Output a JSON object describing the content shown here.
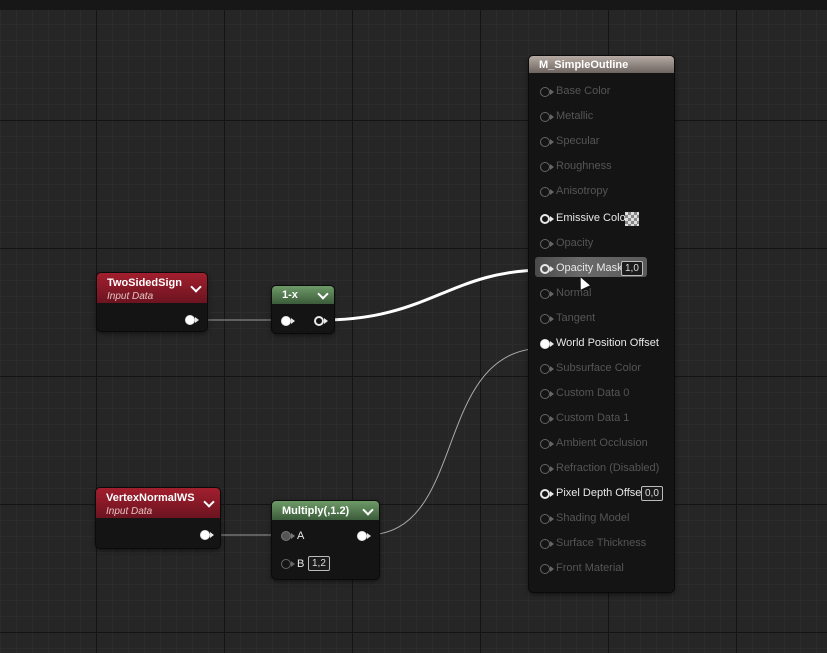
{
  "graph": {
    "two_sided_node": {
      "title": "TwoSidedSign",
      "subtitle": "Input Data"
    },
    "one_minus_node": {
      "title": "1-x"
    },
    "vertex_node": {
      "title": "VertexNormalWS",
      "subtitle": "Input Data"
    },
    "multiply_node": {
      "title": "Multiply(,1.2)",
      "pin_a": "A",
      "pin_b": "B",
      "pin_b_value": "1,2"
    },
    "material_node": {
      "title": "M_SimpleOutline",
      "pins": [
        {
          "label": "Base Color",
          "active": false
        },
        {
          "label": "Metallic",
          "active": false
        },
        {
          "label": "Specular",
          "active": false
        },
        {
          "label": "Roughness",
          "active": false
        },
        {
          "label": "Anisotropy",
          "active": false
        },
        {
          "label": "Emissive Color",
          "active": true
        },
        {
          "label": "Opacity",
          "active": false
        },
        {
          "label": "Opacity Mask",
          "active": true,
          "value": "1,0"
        },
        {
          "label": "Normal",
          "active": false
        },
        {
          "label": "Tangent",
          "active": false
        },
        {
          "label": "World Position Offset",
          "active": true
        },
        {
          "label": "Subsurface Color",
          "active": false
        },
        {
          "label": "Custom Data 0",
          "active": false
        },
        {
          "label": "Custom Data 1",
          "active": false
        },
        {
          "label": "Ambient Occlusion",
          "active": false
        },
        {
          "label": "Refraction (Disabled)",
          "active": false
        },
        {
          "label": "Pixel Depth Offset",
          "active": true,
          "value": "0,0"
        },
        {
          "label": "Shading Model",
          "active": false
        },
        {
          "label": "Surface Thickness",
          "active": false
        },
        {
          "label": "Front Material",
          "active": false
        }
      ]
    }
  },
  "colors": {
    "input_header": "#a21f2e",
    "math_header": "#6e9a68",
    "material_header": "#b6aaa4",
    "wire": "#ffffff"
  }
}
